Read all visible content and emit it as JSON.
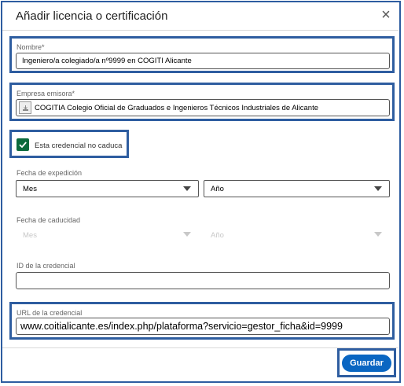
{
  "dialog": {
    "title": "Añadir licencia o certificación",
    "close_glyph": "×"
  },
  "fields": {
    "name": {
      "label": "Nombre*",
      "value": "Ingeniero/a colegiado/a nº9999 en COGITI Alicante"
    },
    "issuer": {
      "label": "Empresa emisora*",
      "value": "COGITIA Colegio Oficial de Graduados e Ingenieros Técnicos Industriales de Alicante",
      "logo_icon": "company-logo-placeholder-icon"
    },
    "no_expiry": {
      "label": "Esta credencial no caduca",
      "checked": true
    },
    "issue_date": {
      "label": "Fecha de expedición",
      "month": "Mes",
      "year": "Año"
    },
    "expiry_date": {
      "label": "Fecha de caducidad",
      "month": "Mes",
      "year": "Año",
      "disabled": true
    },
    "credential_id": {
      "label": "ID de la credencial",
      "value": ""
    },
    "credential_url": {
      "label": "URL de la credencial",
      "value": "www.coitialicante.es/index.php/plataforma?servicio=gestor_ficha&id=9999"
    }
  },
  "actions": {
    "save_label": "Guardar"
  },
  "colors": {
    "highlight": "#2e5da0",
    "primary": "#0a66c2",
    "checkbox": "#0b6a3c"
  }
}
